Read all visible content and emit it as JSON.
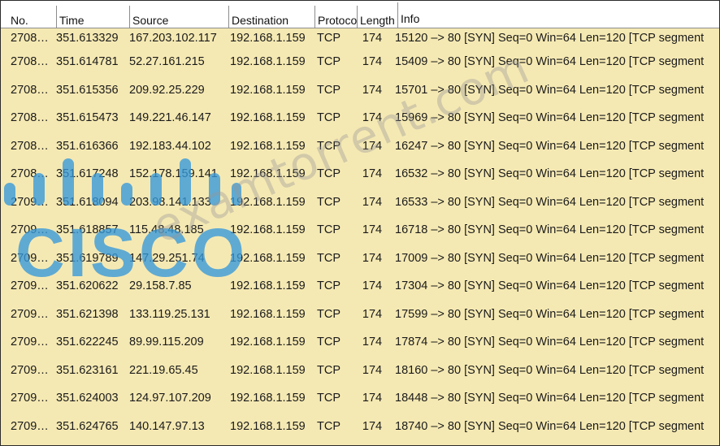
{
  "columns": {
    "no": "No.",
    "time": "Time",
    "source": "Source",
    "destination": "Destination",
    "protocol": "Protocol",
    "length": "Length",
    "info": "Info"
  },
  "packets": [
    {
      "no": "2708…",
      "time": "351.613329",
      "source": "167.203.102.117",
      "destination": "192.168.1.159",
      "protocol": "TCP",
      "length": "174",
      "info": "15120 –> 80 [SYN] Seq=0 Win=64 Len=120 [TCP segment"
    },
    {
      "no": "2708…",
      "time": "351.614781",
      "source": "52.27.161.215",
      "destination": "192.168.1.159",
      "protocol": "TCP",
      "length": "174",
      "info": "15409 –> 80 [SYN] Seq=0 Win=64 Len=120 [TCP segment"
    },
    {
      "no": "2708…",
      "time": "351.615356",
      "source": "209.92.25.229",
      "destination": "192.168.1.159",
      "protocol": "TCP",
      "length": "174",
      "info": "15701 –> 80 [SYN] Seq=0 Win=64 Len=120 [TCP segment"
    },
    {
      "no": "2708…",
      "time": "351.615473",
      "source": "149.221.46.147",
      "destination": "192.168.1.159",
      "protocol": "TCP",
      "length": "174",
      "info": "15969 –> 80 [SYN] Seq=0 Win=64 Len=120 [TCP segment"
    },
    {
      "no": "2708…",
      "time": "351.616366",
      "source": "192.183.44.102",
      "destination": "192.168.1.159",
      "protocol": "TCP",
      "length": "174",
      "info": "16247 –> 80 [SYN] Seq=0 Win=64 Len=120 [TCP segment"
    },
    {
      "no": "2708…",
      "time": "351.617248",
      "source": "152.178.159.141",
      "destination": "192.168.1.159",
      "protocol": "TCP",
      "length": "174",
      "info": "16532 –> 80 [SYN] Seq=0 Win=64 Len=120 [TCP segment"
    },
    {
      "no": "2709…",
      "time": "351.618094",
      "source": "203.98.141.133",
      "destination": "192.168.1.159",
      "protocol": "TCP",
      "length": "174",
      "info": "16533 –> 80 [SYN] Seq=0 Win=64 Len=120 [TCP segment"
    },
    {
      "no": "2709…",
      "time": "351.618857",
      "source": "115.48.48.185",
      "destination": "192.168.1.159",
      "protocol": "TCP",
      "length": "174",
      "info": "16718 –> 80 [SYN] Seq=0 Win=64 Len=120 [TCP segment"
    },
    {
      "no": "2709…",
      "time": "351.619789",
      "source": "147.29.251.74",
      "destination": "192.168.1.159",
      "protocol": "TCP",
      "length": "174",
      "info": "17009 –> 80 [SYN] Seq=0 Win=64 Len=120 [TCP segment"
    },
    {
      "no": "2709…",
      "time": "351.620622",
      "source": "29.158.7.85",
      "destination": "192.168.1.159",
      "protocol": "TCP",
      "length": "174",
      "info": "17304 –> 80 [SYN] Seq=0 Win=64 Len=120 [TCP segment"
    },
    {
      "no": "2709…",
      "time": "351.621398",
      "source": "133.119.25.131",
      "destination": "192.168.1.159",
      "protocol": "TCP",
      "length": "174",
      "info": "17599 –> 80 [SYN] Seq=0 Win=64 Len=120 [TCP segment"
    },
    {
      "no": "2709…",
      "time": "351.622245",
      "source": "89.99.115.209",
      "destination": "192.168.1.159",
      "protocol": "TCP",
      "length": "174",
      "info": "17874 –> 80 [SYN] Seq=0 Win=64 Len=120 [TCP segment"
    },
    {
      "no": "2709…",
      "time": "351.623161",
      "source": "221.19.65.45",
      "destination": "192.168.1.159",
      "protocol": "TCP",
      "length": "174",
      "info": "18160 –> 80 [SYN] Seq=0 Win=64 Len=120 [TCP segment"
    },
    {
      "no": "2709…",
      "time": "351.624003",
      "source": "124.97.107.209",
      "destination": "192.168.1.159",
      "protocol": "TCP",
      "length": "174",
      "info": "18448 –> 80 [SYN] Seq=0 Win=64 Len=120 [TCP segment"
    },
    {
      "no": "2709…",
      "time": "351.624765",
      "source": "140.147.97.13",
      "destination": "192.168.1.159",
      "protocol": "TCP",
      "length": "174",
      "info": "18740 –> 80 [SYN] Seq=0 Win=64 Len=120 [TCP segment"
    }
  ],
  "colors": {
    "row_background": "#f5e9b3",
    "header_background": "#ffffff",
    "watermark_logo": "#3498db"
  },
  "watermarks": {
    "logo_text": "CISCO",
    "site_text": "examtorrent.com"
  }
}
